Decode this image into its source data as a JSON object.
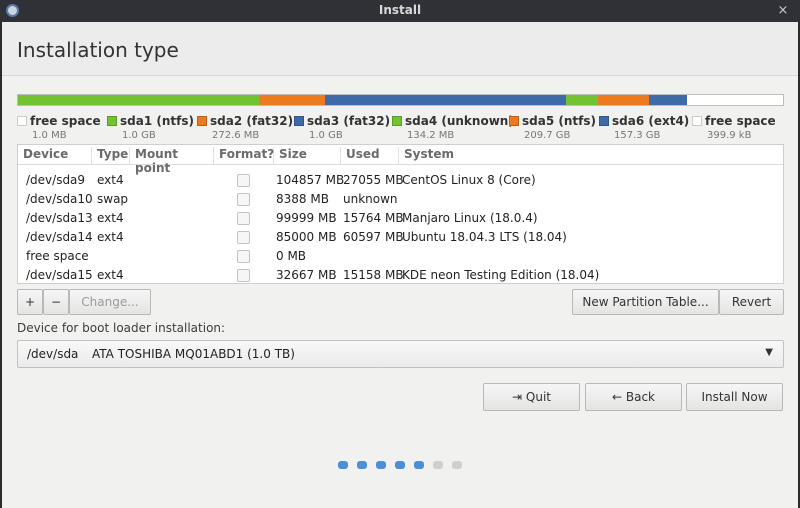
{
  "window": {
    "title": "Install",
    "close_glyph": "×",
    "app_icon": "installer-icon"
  },
  "page": {
    "title": "Installation type"
  },
  "partition_bar": {
    "segments": [
      {
        "name": "free space",
        "size_mb": 1.0,
        "color": "#ffffff"
      },
      {
        "name": "sda1",
        "size_mb": 1000,
        "color": "#73c233"
      },
      {
        "name": "sda2",
        "size_mb": 272.6,
        "color": "#ed7a1f"
      },
      {
        "name": "sda3",
        "size_mb": 1000,
        "color": "#3e6ba8"
      },
      {
        "name": "sda4",
        "size_mb": 134.2,
        "color": "#73c233"
      },
      {
        "name": "sda5",
        "size_mb": 209.7,
        "color": "#ed7a1f"
      },
      {
        "name": "sda6",
        "size_mb": 157.3,
        "color": "#3e6ba8"
      },
      {
        "name": "free space",
        "size_mb": 399.9,
        "color": "#ffffff"
      }
    ]
  },
  "legend": [
    {
      "name": "free space",
      "size": "1.0 MB",
      "color": "#ffffff"
    },
    {
      "name": "sda1 (ntfs)",
      "size": "1.0 GB",
      "color": "#73c233"
    },
    {
      "name": "sda2 (fat32)",
      "size": "272.6 MB",
      "color": "#ed7a1f"
    },
    {
      "name": "sda3 (fat32)",
      "size": "1.0 GB",
      "color": "#3e6ba8"
    },
    {
      "name": "sda4 (unknown)",
      "size": "134.2 MB",
      "color": "#73c233"
    },
    {
      "name": "sda5 (ntfs)",
      "size": "209.7 GB",
      "color": "#ed7a1f"
    },
    {
      "name": "sda6 (ext4)",
      "size": "157.3 GB",
      "color": "#3e6ba8"
    },
    {
      "name": "free space",
      "size": "399.9 kB",
      "color": "#ffffff"
    }
  ],
  "table": {
    "headers": [
      "Device",
      "Type",
      "Mount point",
      "Format?",
      "Size",
      "Used",
      "System"
    ],
    "rows": [
      {
        "device": "/dev/sda9",
        "type": "ext4",
        "mount": "",
        "format": false,
        "size": "104857 MB",
        "used": "27055 MB",
        "system": "CentOS Linux 8 (Core)"
      },
      {
        "device": "/dev/sda10",
        "type": "swap",
        "mount": "",
        "format": false,
        "size": "8388 MB",
        "used": "unknown",
        "system": ""
      },
      {
        "device": "/dev/sda13",
        "type": "ext4",
        "mount": "",
        "format": false,
        "size": "99999 MB",
        "used": "15764 MB",
        "system": "Manjaro Linux (18.0.4)"
      },
      {
        "device": "/dev/sda14",
        "type": "ext4",
        "mount": "",
        "format": false,
        "size": "85000 MB",
        "used": "60597 MB",
        "system": "Ubuntu 18.04.3 LTS (18.04)"
      },
      {
        "device": "free space",
        "type": "",
        "mount": "",
        "format": false,
        "size": "0 MB",
        "used": "",
        "system": ""
      },
      {
        "device": "/dev/sda15",
        "type": "ext4",
        "mount": "",
        "format": false,
        "size": "32667 MB",
        "used": "15158 MB",
        "system": "KDE neon Testing Edition (18.04)"
      }
    ]
  },
  "toolbar": {
    "add_label": "+",
    "remove_label": "−",
    "change_label": "Change...",
    "new_table_label": "New Partition Table...",
    "revert_label": "Revert"
  },
  "bootloader": {
    "label": "Device for boot loader installation:",
    "device": "/dev/sda",
    "description": "ATA TOSHIBA MQ01ABD1 (1.0 TB)"
  },
  "nav": {
    "quit_label": "Quit",
    "back_label": "Back",
    "install_label": "Install Now",
    "quit_glyph": "⇥",
    "back_glyph": "←"
  },
  "progress": {
    "total_steps": 7,
    "completed_steps": 5,
    "active_color": "#4a90d9",
    "inactive_color": "#cfcfcf"
  }
}
